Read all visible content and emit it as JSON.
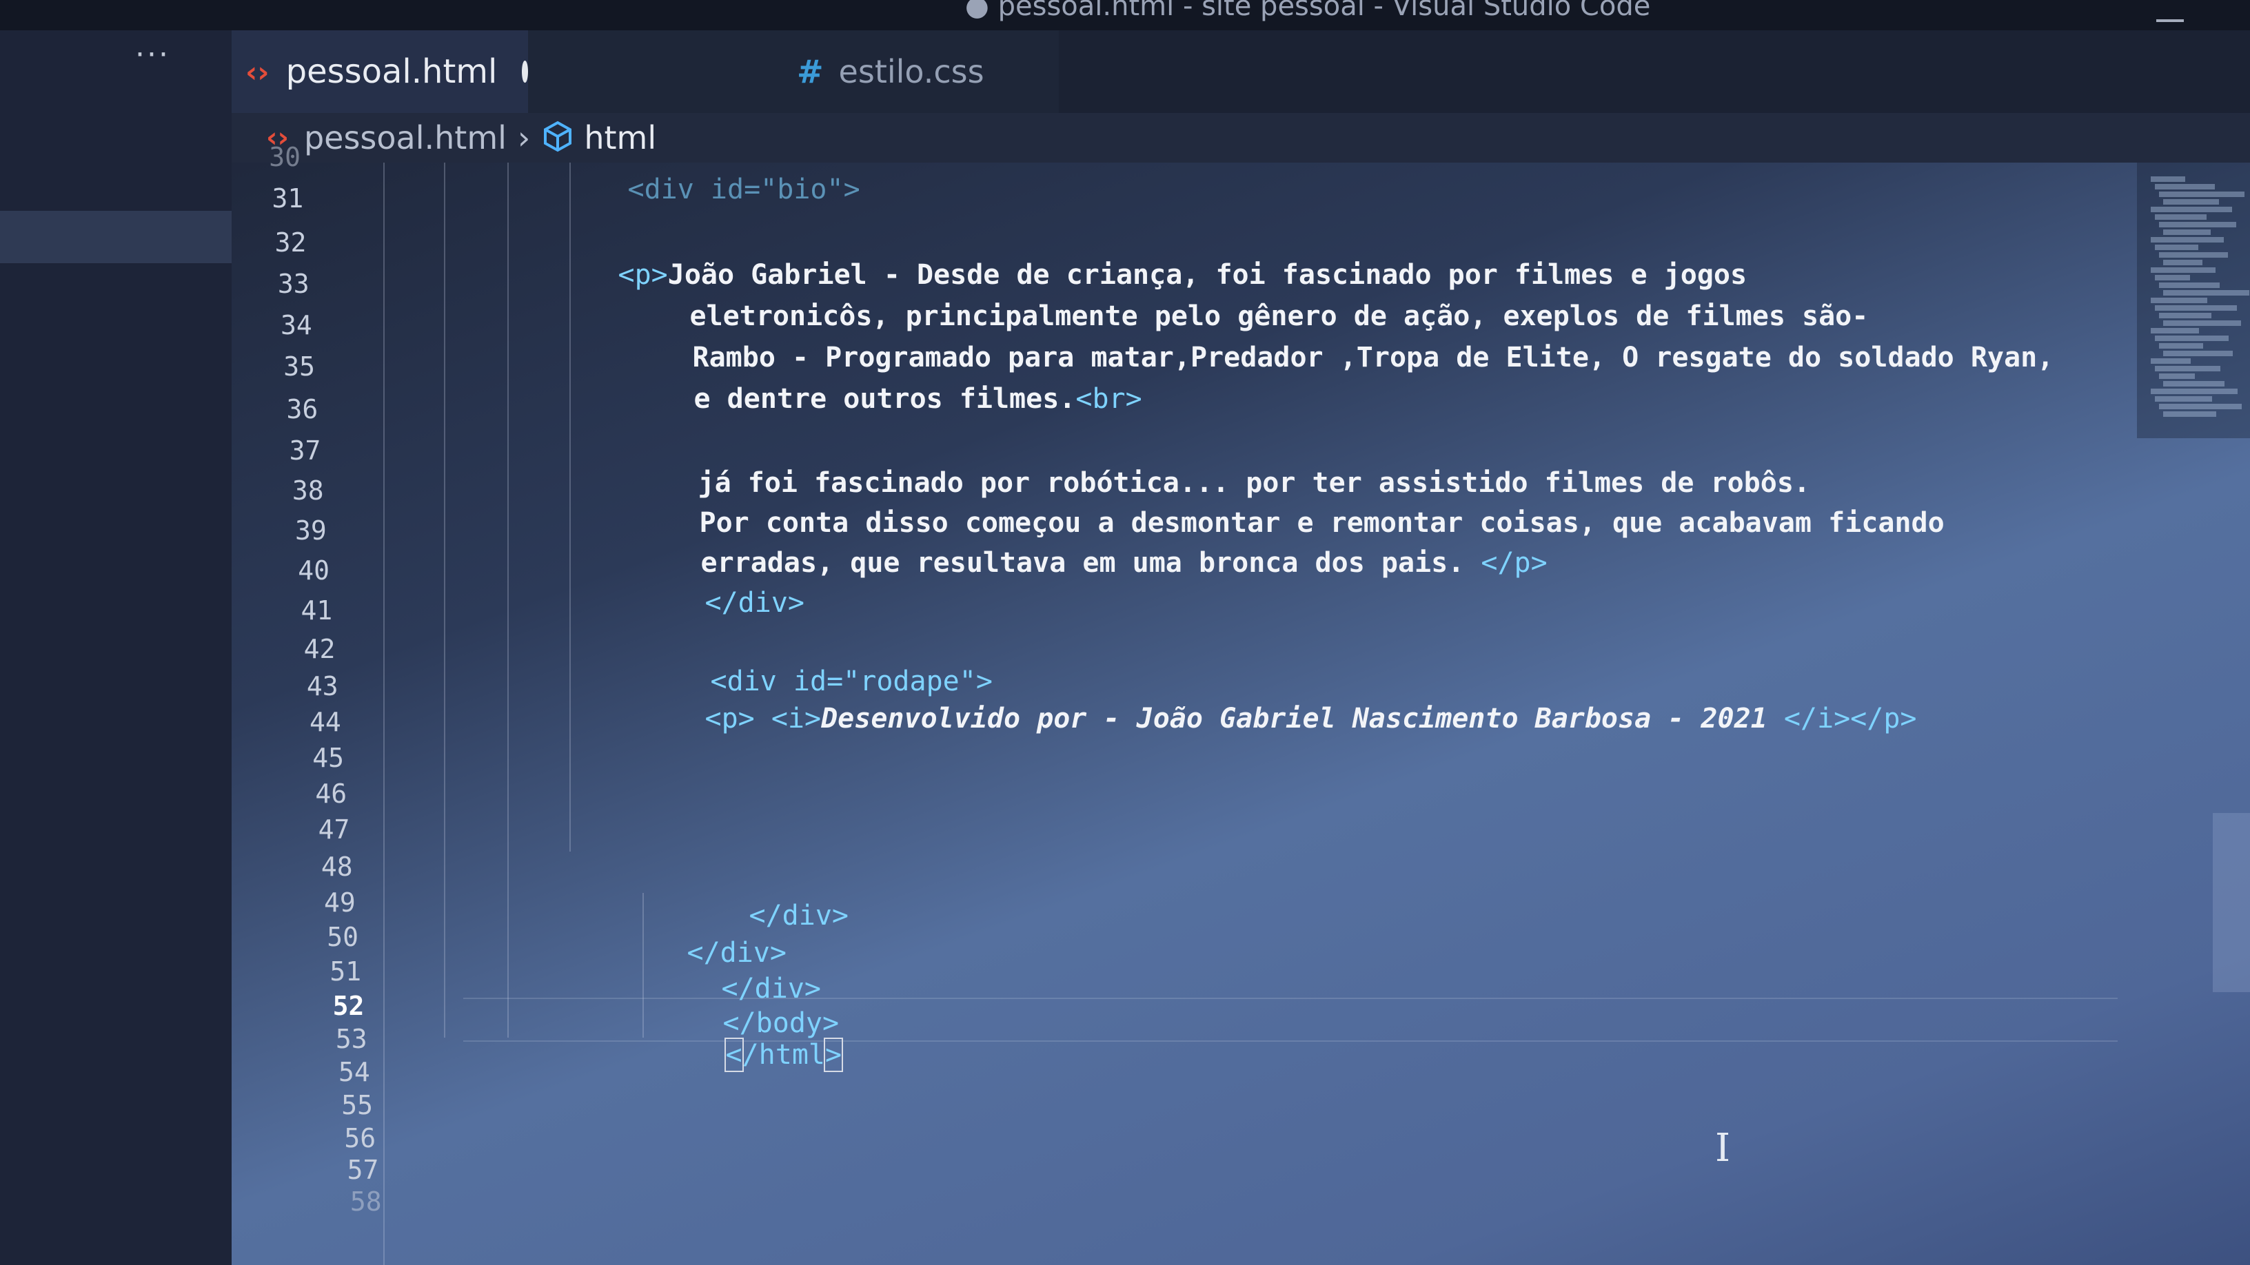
{
  "window": {
    "title": "● pessoal.html - site pessoal - Visual Studio Code"
  },
  "sidebar": {
    "more_icon": "···"
  },
  "tabs": [
    {
      "label": "pessoal.html",
      "icon": "html-icon",
      "active": true,
      "unsaved": true
    },
    {
      "label": "estilo.css",
      "icon": "css-icon",
      "active": false,
      "unsaved": false
    }
  ],
  "breadcrumb": {
    "file": "pessoal.html",
    "separator": "›",
    "element": "html"
  },
  "gutter": {
    "line_numbers": [
      "30",
      "31",
      "32",
      "33",
      "34",
      "35",
      "36",
      "37",
      "38",
      "39",
      "40",
      "41",
      "42",
      "43",
      "44",
      "45",
      "46",
      "47",
      "48",
      "49",
      "50",
      "51",
      "52",
      "53",
      "54",
      "55",
      "56",
      "57",
      "58"
    ],
    "active_line": "52"
  },
  "code": {
    "line30": "<div id=\"bio\">",
    "line32_open": "<p>",
    "line32_text": "João Gabriel - Desde de criança, foi fascinado por filmes e jogos",
    "line33": "eletronicôs, principalmente pelo gênero de ação, exeplos de filmes são-",
    "line34": "Rambo - Programado para matar,Predador ,Tropa de Elite, O resgate do soldado Ryan,",
    "line35_text": "e dentre outros filmes.",
    "line35_tag": "<br>",
    "line37": "já foi fascinado por robótica... por ter assistido filmes de robôs.",
    "line38": "Por conta disso começou a desmontar e remontar coisas, que acabavam ficando",
    "line39_text": "erradas, que resultava em uma bronca dos pais. ",
    "line39_tag": "</p>",
    "line40": "</div>",
    "line42": "<div id=\"rodape\">",
    "line43_open": "<p> <i>",
    "line43_text": "Desenvolvido por - João Gabriel Nascimento Barbosa - 2021 ",
    "line43_close": "</i></p>",
    "line48": "</div>",
    "line49": "</div>",
    "line50": "</div>",
    "line51": "</body>",
    "line52_lt": "<",
    "line52_mid": "/html",
    "line52_gt": ">"
  },
  "colors": {
    "tag": "#7fd3ff",
    "text": "#f2f4f8",
    "html_icon": "#e44d3a",
    "css_icon": "#3b9bd8"
  }
}
